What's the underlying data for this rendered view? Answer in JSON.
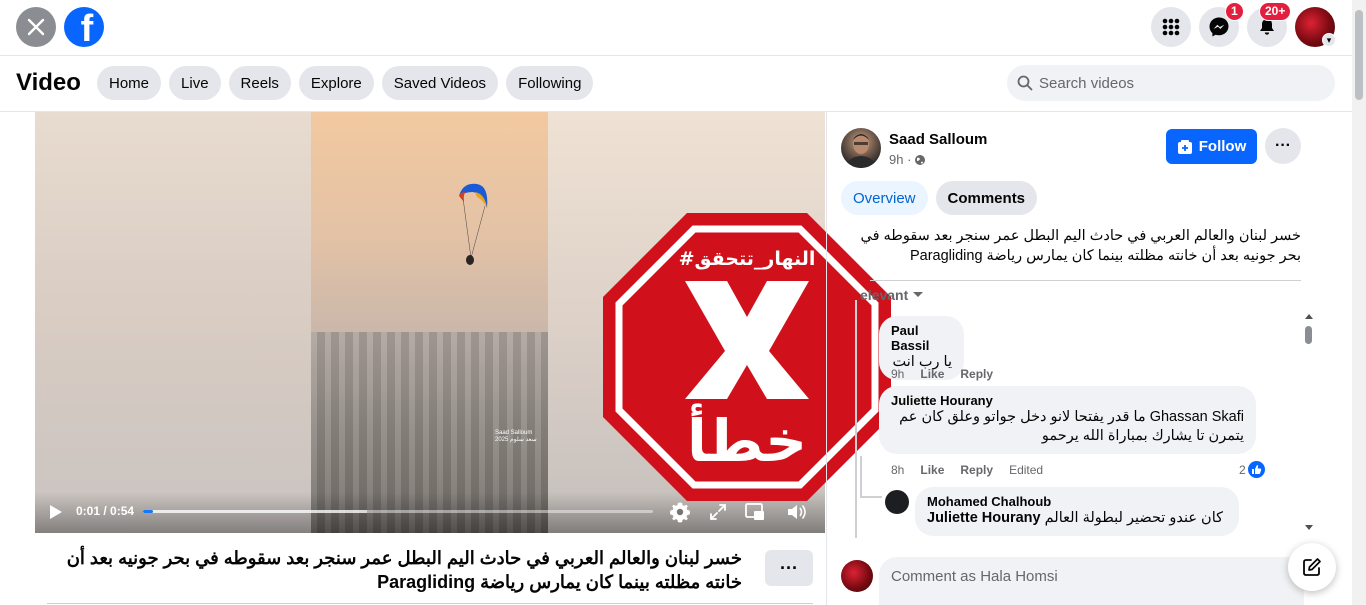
{
  "header": {
    "close_icon": "close-icon",
    "logo_letter": "f",
    "messenger_badge": "1",
    "notifications_badge": "20+"
  },
  "nav": {
    "title": "Video",
    "tabs": [
      {
        "label": "Home"
      },
      {
        "label": "Live"
      },
      {
        "label": "Reels"
      },
      {
        "label": "Explore"
      },
      {
        "label": "Saved Videos"
      },
      {
        "label": "Following"
      }
    ],
    "search_placeholder": "Search videos"
  },
  "video": {
    "time": "0:01 / 0:54",
    "progress_fraction": 0.02,
    "watermark_line1": "Saad Salloum",
    "watermark_line2": "سعد سلوم 2025",
    "stamp_hashtag": "#النهار_تتحقق",
    "stamp_verdict": "خطأ",
    "stamp_color": "#d0101b"
  },
  "caption": {
    "text": "خسر لبنان والعالم العربي في حادث اليم البطل عمر سنجر بعد سقوطه في بحر جونيه بعد أن خانته مظلته بينما كان يمارس رياضة Paragliding",
    "more_label": "···"
  },
  "post": {
    "author": "Saad Salloum",
    "time": "9h ·",
    "follow_label": "Follow",
    "more_label": "···",
    "tabs": [
      {
        "label": "Overview"
      },
      {
        "label": "Comments"
      }
    ],
    "text": "خسر لبنان والعالم العربي في حادث اليم البطل عمر سنجر بعد سقوطه في بحر جونيه بعد أن خانته مظلته بينما كان يمارس رياضة Paragliding",
    "sort_label": "elevant"
  },
  "comments": [
    {
      "name": "Paul Bassil",
      "text": "يا رب انت",
      "time": "9h",
      "like": "Like",
      "reply": "Reply"
    },
    {
      "name": "Juliette Hourany",
      "line1": "Ghassan Skafi ما قدر يفتحا لانو دخل جواتو وعلق كان عم",
      "line2": "يتمرن تا يشارك بمباراة الله يرحمو",
      "time": "8h",
      "like": "Like",
      "reply": "Reply",
      "edited": "Edited",
      "reactions": "2"
    },
    {
      "name": "Mohamed Chalhoub",
      "mention": "Juliette Hourany",
      "text": "كان عندو تحضير لبطولة العالم"
    }
  ],
  "composer": {
    "placeholder": "Comment as Hala Homsi"
  },
  "colors": {
    "accent": "#0866ff",
    "badge": "#e41e3f"
  }
}
